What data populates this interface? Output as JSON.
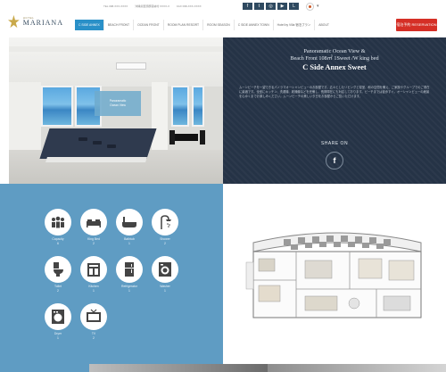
{
  "header": {
    "logo_sub": "HOTEL",
    "logo_main": "MARIANA",
    "info_items": [
      "TEL 098-XXX-XXXX",
      "沖縄県国頭郡恩納村 XXXX-X",
      "FAX 098-XXX-XXXX"
    ],
    "social_icons": [
      "facebook-icon",
      "twitter-icon",
      "instagram-icon",
      "youtube-icon",
      "line-icon"
    ],
    "nav": [
      {
        "label": "C SIDE ANNEX",
        "active": true
      },
      {
        "label": "BEACH FRONT",
        "active": false
      },
      {
        "label": "OCEAN FRONT",
        "active": false
      },
      {
        "label": "ROOM PLAN RESORT",
        "active": false
      },
      {
        "label": "ROOM SEASON",
        "active": false
      },
      {
        "label": "C SIDE ANNEX TOWN",
        "active": false
      },
      {
        "label": "Hotel by Villa 宿泊プラン",
        "active": false
      },
      {
        "label": "ABOUT",
        "active": false
      }
    ],
    "reserve_label": "宿泊予約 RESERVATION"
  },
  "photo": {
    "tooltip_line1": "Panoramatic",
    "tooltip_line2": "Ocean View"
  },
  "panel": {
    "title_line1": "Panoramatic Ocean View &",
    "title_line2": "Beach Front 108㎡ 1Sweet /W king bed",
    "title_bold": "C Side Annex Sweet",
    "desc": "ムーンビーチを一望できるパノラマオーシャンビューのお部屋です。広々としたリビングと寝室、和の空間を備え、ご家族やグループでのご滞在に最適です。全室にキッチン、洗濯機、乾燥機などを完備し、長期滞在にも対応しております。ビーチまでは徒歩すぐ。オーシャンビューの絶景を心ゆくまでお楽しみください。ムーンビーチの美しい夕日をお部屋からご覧いただけます。",
    "share_label": "SHARE ON",
    "facebook_glyph": "f"
  },
  "amenities": [
    {
      "label": "Capacity",
      "count": "6",
      "icon": "people-icon"
    },
    {
      "label": "King Bed",
      "count": "2",
      "icon": "bed-icon"
    },
    {
      "label": "Bathtub",
      "count": "1",
      "icon": "bathtub-icon"
    },
    {
      "label": "Shower",
      "count": "2",
      "icon": "shower-icon"
    },
    {
      "label": "Toilet",
      "count": "2",
      "icon": "toilet-icon"
    },
    {
      "label": "Kitchen",
      "count": "1",
      "icon": "kitchen-icon"
    },
    {
      "label": "Refrigerator",
      "count": "1",
      "icon": "refrigerator-icon"
    },
    {
      "label": "Washer",
      "count": "1",
      "icon": "washer-icon"
    },
    {
      "label": "Dryer",
      "count": "1",
      "icon": "dryer-icon"
    },
    {
      "label": "TV",
      "count": "2",
      "icon": "tv-icon"
    }
  ],
  "colors": {
    "nav_active": "#2a90c8",
    "reserve": "#d52f26",
    "panel_bg": "#253346",
    "amenity_bg": "#5f9cc3"
  }
}
